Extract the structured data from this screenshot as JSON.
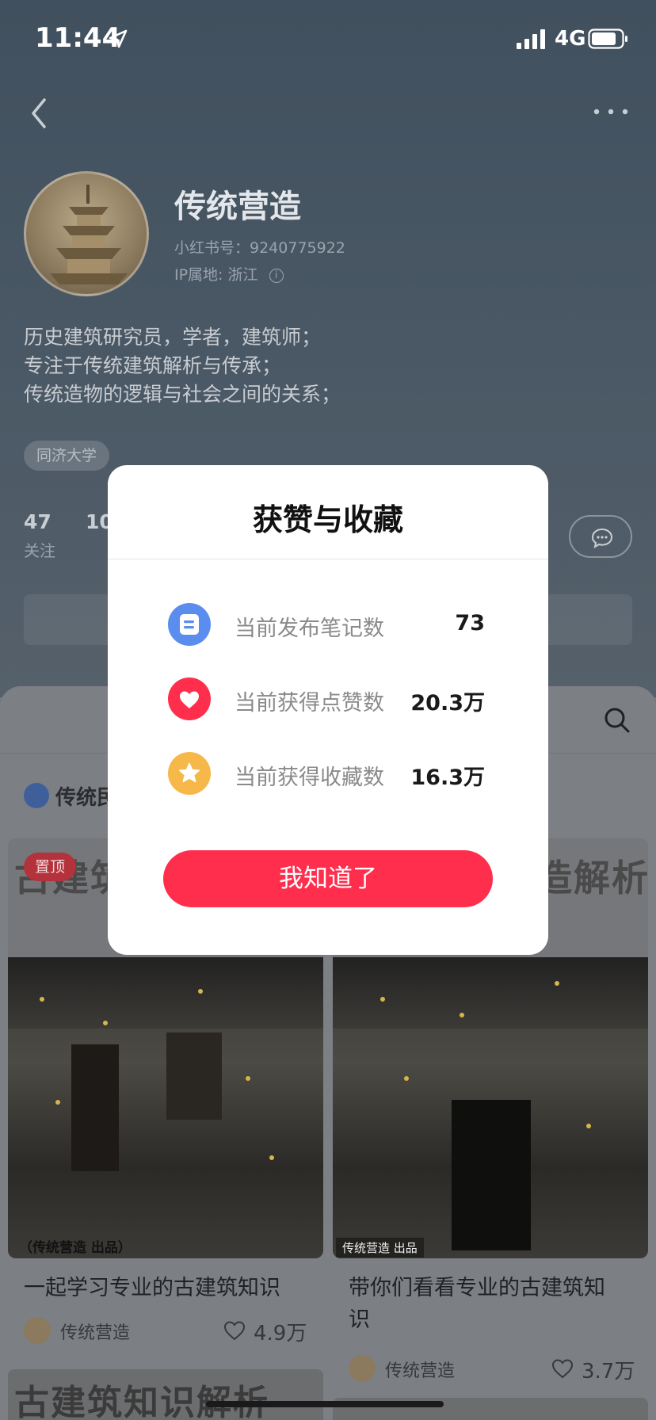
{
  "status_bar": {
    "time": "11:44",
    "network": "4G"
  },
  "profile": {
    "name": "传统营造",
    "red_id": "小红书号：9240775922",
    "ip_location": "IP属地: 浙江",
    "bio": [
      "历史建筑研究员，学者，建筑师；",
      "专注于传统建筑解析与传承；",
      "传统造物的逻辑与社会之间的关系；"
    ],
    "tag": "同济大学",
    "stats": [
      {
        "value": "47",
        "label": "关注"
      },
      {
        "value": "10",
        "label": ""
      }
    ]
  },
  "collection": {
    "label": "传统民"
  },
  "modal": {
    "title": "获赞与收藏",
    "rows": [
      {
        "icon": "note-icon",
        "color": "#5b8def",
        "label": "当前发布笔记数",
        "value": "73"
      },
      {
        "icon": "heart-icon",
        "color": "#ff2e4d",
        "label": "当前获得点赞数",
        "value": "20.3万"
      },
      {
        "icon": "star-icon",
        "color": "#f7b84a",
        "label": "当前获得收藏数",
        "value": "16.3万"
      }
    ],
    "confirm": "我知道了"
  },
  "cards": [
    {
      "pin": "置顶",
      "headline": "古建筑",
      "credit": "（传统营造 出品）",
      "title": "一起学习专业的古建筑知识",
      "author": "传统营造",
      "likes": "4.9万"
    },
    {
      "headline": "造解析",
      "credit": "传统营造 出品",
      "title": "带你们看看专业的古建筑知识",
      "author": "传统营造",
      "likes": "3.7万"
    }
  ],
  "bottom_card": {
    "headline": "古建筑知识解析"
  },
  "colors": {
    "accent": "#ff2e4d",
    "note_blue": "#5b8def",
    "star_gold": "#f7b84a"
  }
}
